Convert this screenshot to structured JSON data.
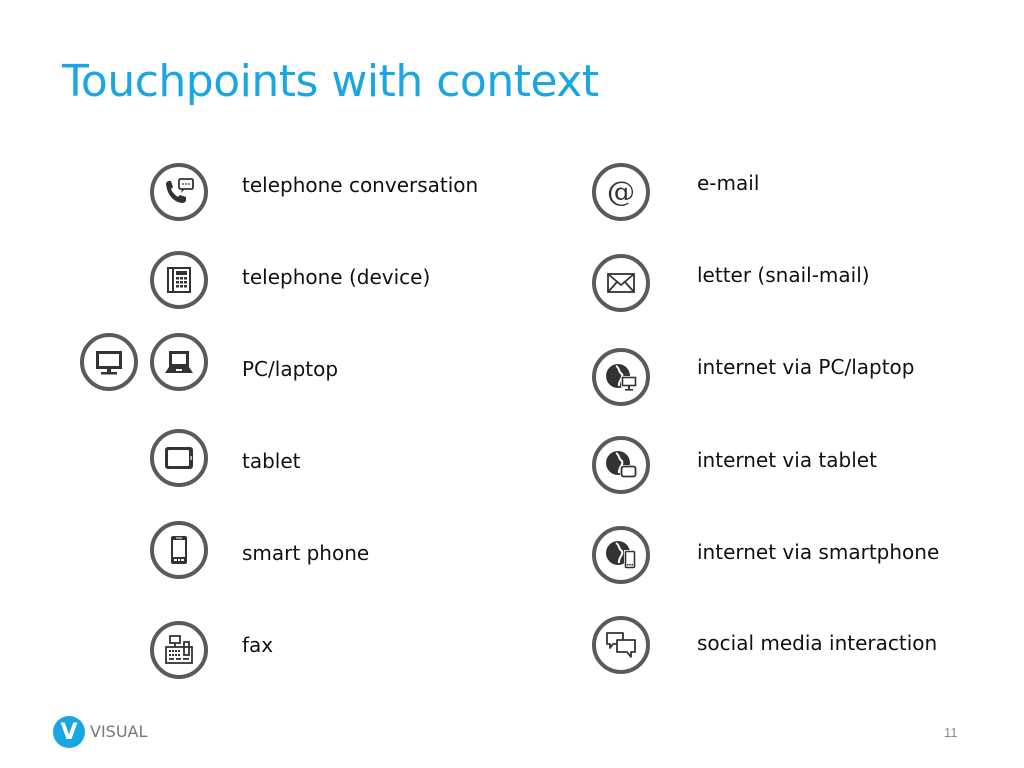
{
  "slide": {
    "title": "Touchpoints with context",
    "page_number": "11",
    "title_color": "#1aa6e3"
  },
  "footer": {
    "logo_letter": "V",
    "brand": "VISUAL"
  },
  "left_column": [
    {
      "label": "telephone conversation",
      "icons": [
        "phone-chat-icon"
      ]
    },
    {
      "label": "telephone (device)",
      "icons": [
        "desk-phone-icon"
      ]
    },
    {
      "label": "PC/laptop",
      "icons": [
        "monitor-icon",
        "laptop-icon"
      ]
    },
    {
      "label": "tablet",
      "icons": [
        "tablet-icon"
      ]
    },
    {
      "label": "smart phone",
      "icons": [
        "smartphone-icon"
      ]
    },
    {
      "label": "fax",
      "icons": [
        "fax-icon"
      ]
    }
  ],
  "right_column": [
    {
      "label": "e-mail",
      "icons": [
        "at-sign-icon"
      ]
    },
    {
      "label": "letter (snail-mail)",
      "icons": [
        "envelope-icon"
      ]
    },
    {
      "label": "internet via PC/laptop",
      "icons": [
        "globe-monitor-icon"
      ]
    },
    {
      "label": "internet via tablet",
      "icons": [
        "globe-tablet-icon"
      ]
    },
    {
      "label": "internet via smartphone",
      "icons": [
        "globe-smartphone-icon"
      ]
    },
    {
      "label": "social media interaction",
      "icons": [
        "chat-bubbles-icon"
      ]
    }
  ]
}
